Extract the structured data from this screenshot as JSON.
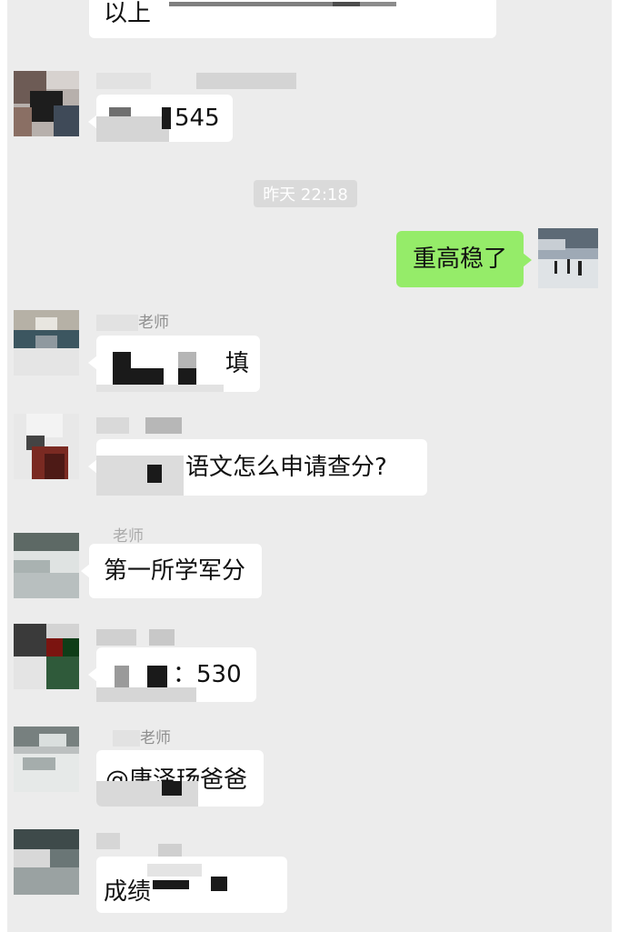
{
  "timestamp": "昨天 22:18",
  "messages": [
    {
      "text": "以上"
    },
    {
      "text": "545"
    },
    {
      "text": "重高稳了"
    },
    {
      "sender": "老师",
      "text": "填"
    },
    {
      "text": "语文怎么申请查分?"
    },
    {
      "sender": "老师",
      "text": "第一所学军分"
    },
    {
      "text": "：530"
    },
    {
      "sender": "老师",
      "text": "@唐泽玚爸爸"
    },
    {
      "text": "成绩"
    }
  ]
}
